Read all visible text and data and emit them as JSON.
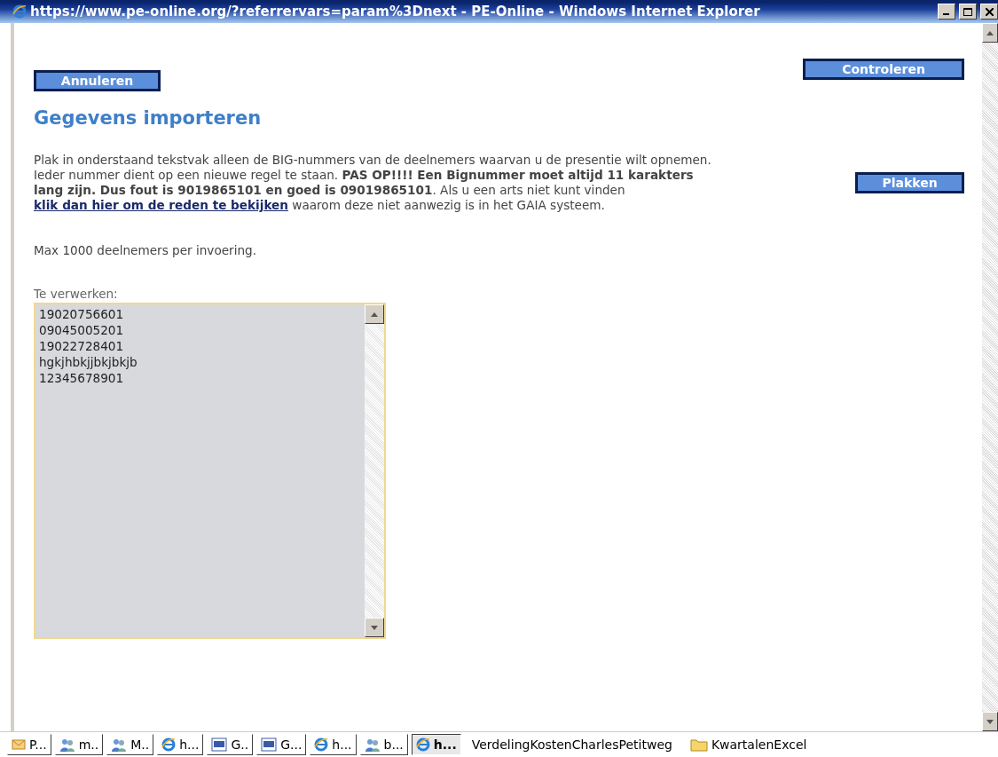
{
  "window": {
    "title": "https://www.pe-online.org/?referrervars=param%3Dnext - PE-Online - Windows Internet Explorer"
  },
  "buttons": {
    "cancel": "Annuleren",
    "check": "Controleren",
    "paste": "Plakken"
  },
  "heading": "Gegevens importeren",
  "intro": {
    "before": "Plak in onderstaand tekstvak alleen de BIG-nummers van de deelnemers waarvan u de presentie wilt opnemen. Ieder nummer dient op een nieuwe regel te staan. **PAS OP!!!! Een Bignummer moet altijd 11 karakters lang zijn. Dus fout is 9019865101 en goed is 09019865101**. Als u een arts niet kunt vinden ",
    "link": "klik dan hier om de reden te bekijken",
    "after": " waarom deze niet aanwezig is in het GAIA systeem."
  },
  "note": "Max 1000 deelnemers per invoering.",
  "field": {
    "label": "Te verwerken:",
    "lines": [
      "19020756601",
      "09045005201",
      "19022728401",
      "hgkjhbkjjbkjbkjb",
      "12345678901"
    ]
  },
  "taskbar": [
    {
      "kind": "outlook",
      "label": "P...",
      "selected": false
    },
    {
      "kind": "people",
      "label": "m..",
      "selected": false
    },
    {
      "kind": "people",
      "label": "M..",
      "selected": false
    },
    {
      "kind": "ie",
      "label": "h...",
      "selected": false
    },
    {
      "kind": "word",
      "label": "G..",
      "selected": false
    },
    {
      "kind": "word",
      "label": "G...",
      "selected": false
    },
    {
      "kind": "ie",
      "label": "h...",
      "selected": false
    },
    {
      "kind": "people",
      "label": "b...",
      "selected": false
    },
    {
      "kind": "ie",
      "label": "h...",
      "selected": true
    }
  ],
  "tray": [
    {
      "kind": "text",
      "label": "VerdelingKostenCharlesPetitweg"
    },
    {
      "kind": "folder",
      "label": "KwartalenExcel"
    }
  ]
}
